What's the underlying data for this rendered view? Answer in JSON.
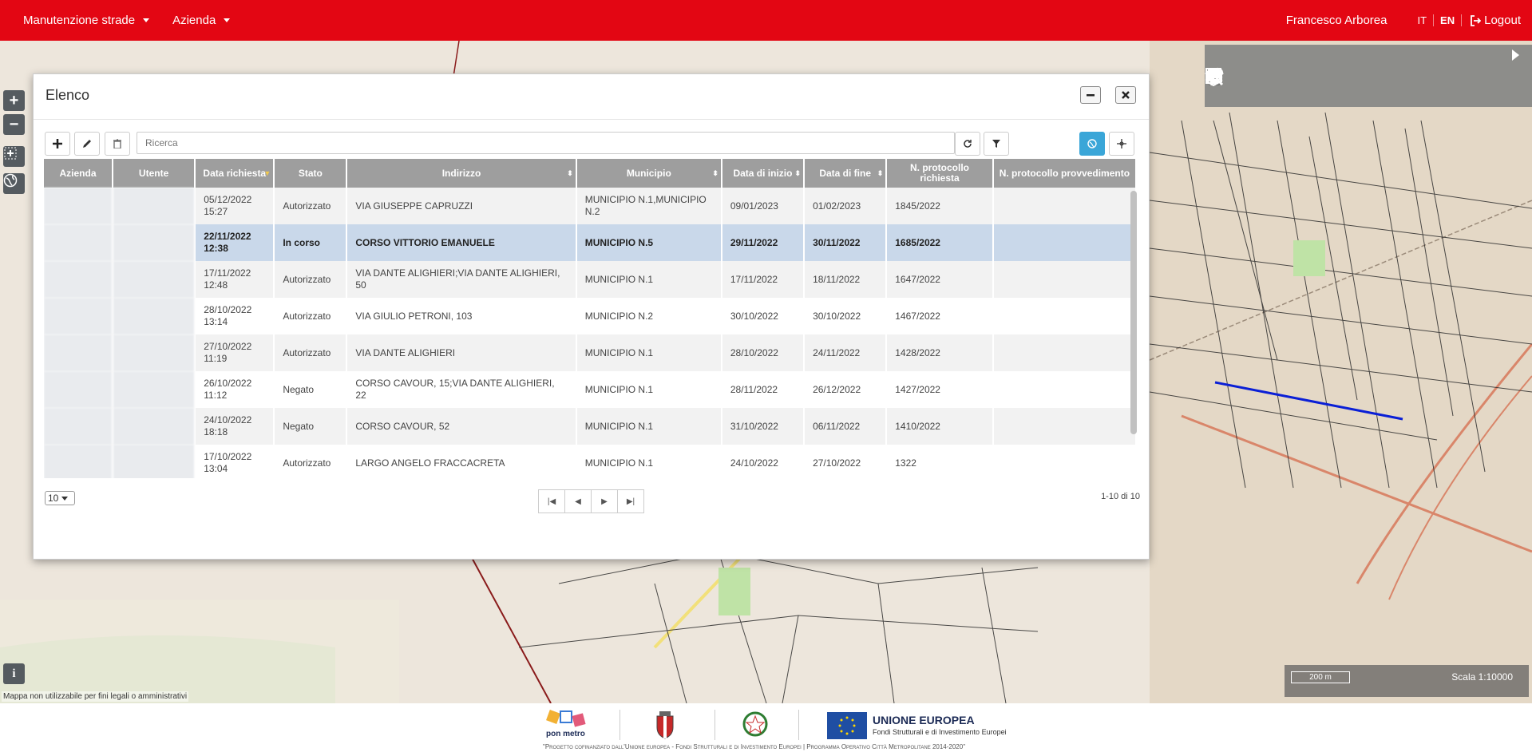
{
  "nav": {
    "menu1": "Manutenzione strade",
    "menu2": "Azienda",
    "user": "Francesco Arborea",
    "lang_it": "IT",
    "lang_en": "EN",
    "logout": "Logout"
  },
  "map": {
    "disclaimer": "Mappa non utilizzabile per fini legali o amministrativi",
    "scale_bar": "200 m",
    "scale_text": "Scala 1:10000",
    "zoom_in": "+",
    "zoom_out": "−",
    "info": "i"
  },
  "dialog": {
    "title": "Elenco",
    "search_placeholder": "Ricerca",
    "columns": [
      "Azienda",
      "Utente",
      "Data richiesta",
      "Stato",
      "Indirizzo",
      "Municipio",
      "Data di inizio",
      "Data di fine",
      "N. protocollo richiesta",
      "N. protocollo provvedimento"
    ],
    "rows": [
      {
        "data": "05/12/2022 15:27",
        "stato": "Autorizzato",
        "indirizzo": "VIA GIUSEPPE CAPRUZZI",
        "municipio": "MUNICIPIO N.1,MUNICIPIO N.2",
        "inizio": "09/01/2023",
        "fine": "01/02/2023",
        "prot": "1845/2022",
        "prov": ""
      },
      {
        "data": "22/11/2022 12:38",
        "stato": "In corso",
        "indirizzo": "CORSO VITTORIO EMANUELE",
        "municipio": "MUNICIPIO N.5",
        "inizio": "29/11/2022",
        "fine": "30/11/2022",
        "prot": "1685/2022",
        "prov": ""
      },
      {
        "data": "17/11/2022 12:48",
        "stato": "Autorizzato",
        "indirizzo": "VIA DANTE ALIGHIERI;VIA DANTE ALIGHIERI, 50",
        "municipio": "MUNICIPIO N.1",
        "inizio": "17/11/2022",
        "fine": "18/11/2022",
        "prot": "1647/2022",
        "prov": ""
      },
      {
        "data": "28/10/2022 13:14",
        "stato": "Autorizzato",
        "indirizzo": "VIA GIULIO PETRONI, 103",
        "municipio": "MUNICIPIO N.2",
        "inizio": "30/10/2022",
        "fine": "30/10/2022",
        "prot": "1467/2022",
        "prov": ""
      },
      {
        "data": "27/10/2022 11:19",
        "stato": "Autorizzato",
        "indirizzo": "VIA DANTE ALIGHIERI",
        "municipio": "MUNICIPIO N.1",
        "inizio": "28/10/2022",
        "fine": "24/11/2022",
        "prot": "1428/2022",
        "prov": ""
      },
      {
        "data": "26/10/2022 11:12",
        "stato": "Negato",
        "indirizzo": "CORSO CAVOUR, 15;VIA DANTE ALIGHIERI, 22",
        "municipio": "MUNICIPIO N.1",
        "inizio": "28/11/2022",
        "fine": "26/12/2022",
        "prot": "1427/2022",
        "prov": ""
      },
      {
        "data": "24/10/2022 18:18",
        "stato": "Negato",
        "indirizzo": "CORSO CAVOUR, 52",
        "municipio": "MUNICIPIO N.1",
        "inizio": "31/10/2022",
        "fine": "06/11/2022",
        "prot": "1410/2022",
        "prov": ""
      },
      {
        "data": "17/10/2022 13:04",
        "stato": "Autorizzato",
        "indirizzo": "LARGO ANGELO FRACCACRETA",
        "municipio": "MUNICIPIO N.1",
        "inizio": "24/10/2022",
        "fine": "27/10/2022",
        "prot": "1322",
        "prov": ""
      }
    ],
    "page_size": "10",
    "count": "1-10 di 10"
  },
  "footer": {
    "pon_label": "pon metro",
    "comune_label": "Comune di Bari",
    "eu_title": "UNIONE EUROPEA",
    "eu_sub": "Fondi Strutturali e di Investimento Europei",
    "caption": "\"Progetto cofinanziato dall'Unione europea - Fondi Strutturali e di Investimento Europei | Programma Operativo Città Metropolitane 2014-2020\""
  },
  "colors": {
    "brand": "#e30613",
    "header_gray": "#9e9e9e",
    "selected_row": "#c9d8ea",
    "highlight_road": "#0a1fd6"
  }
}
